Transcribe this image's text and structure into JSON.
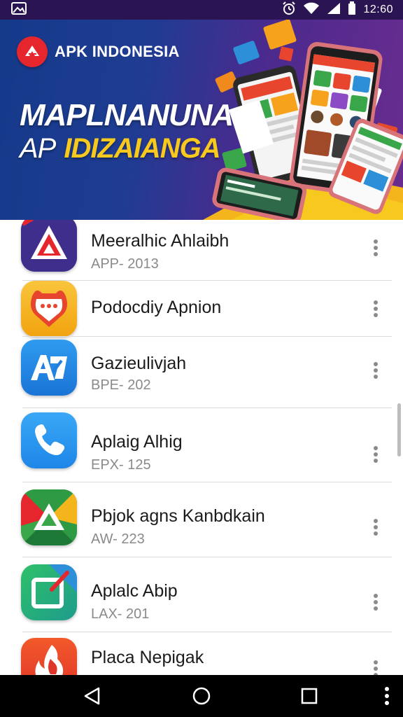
{
  "status_bar": {
    "time": "12:60",
    "icons": [
      "gallery-icon",
      "alarm-icon",
      "wifi-icon",
      "signal-icon",
      "battery-icon"
    ]
  },
  "banner": {
    "brand": "APK INDONESIA",
    "headline_1": "MAPLNANUNA",
    "headline_2a": "AP",
    "headline_2b": "IDIZAIANGA",
    "colors": {
      "accent": "#f7c81e",
      "brand_red": "#e5262c",
      "bg_blue": "#1f3c92",
      "bg_purple": "#6a2c8f"
    }
  },
  "apps": [
    {
      "name": "Meeralhic Ahlaibh",
      "meta": "APP- 2013",
      "icon": "app-triangle-icon"
    },
    {
      "name": "Podocdiy Apnion",
      "meta": "",
      "icon": "app-chat-bubble-icon"
    },
    {
      "name": "Gazieulivjah",
      "meta": "BPE- 202",
      "icon": "app-ae-icon"
    },
    {
      "name": "Aplaig Alhig",
      "meta": "EPX- 125",
      "icon": "app-phone-icon"
    },
    {
      "name": "Pbjok agns Kanbdkain",
      "meta": "AW- 223",
      "icon": "app-triangle-play-icon"
    },
    {
      "name": "Aplalc Abip",
      "meta": "LAX- 201",
      "icon": "app-square-icon"
    },
    {
      "name": "Placa Nepigak",
      "meta": "",
      "icon": "app-flame-icon"
    }
  ],
  "nav": {
    "icons": [
      "back-icon",
      "home-icon",
      "recents-icon",
      "menu-dots-icon"
    ]
  }
}
